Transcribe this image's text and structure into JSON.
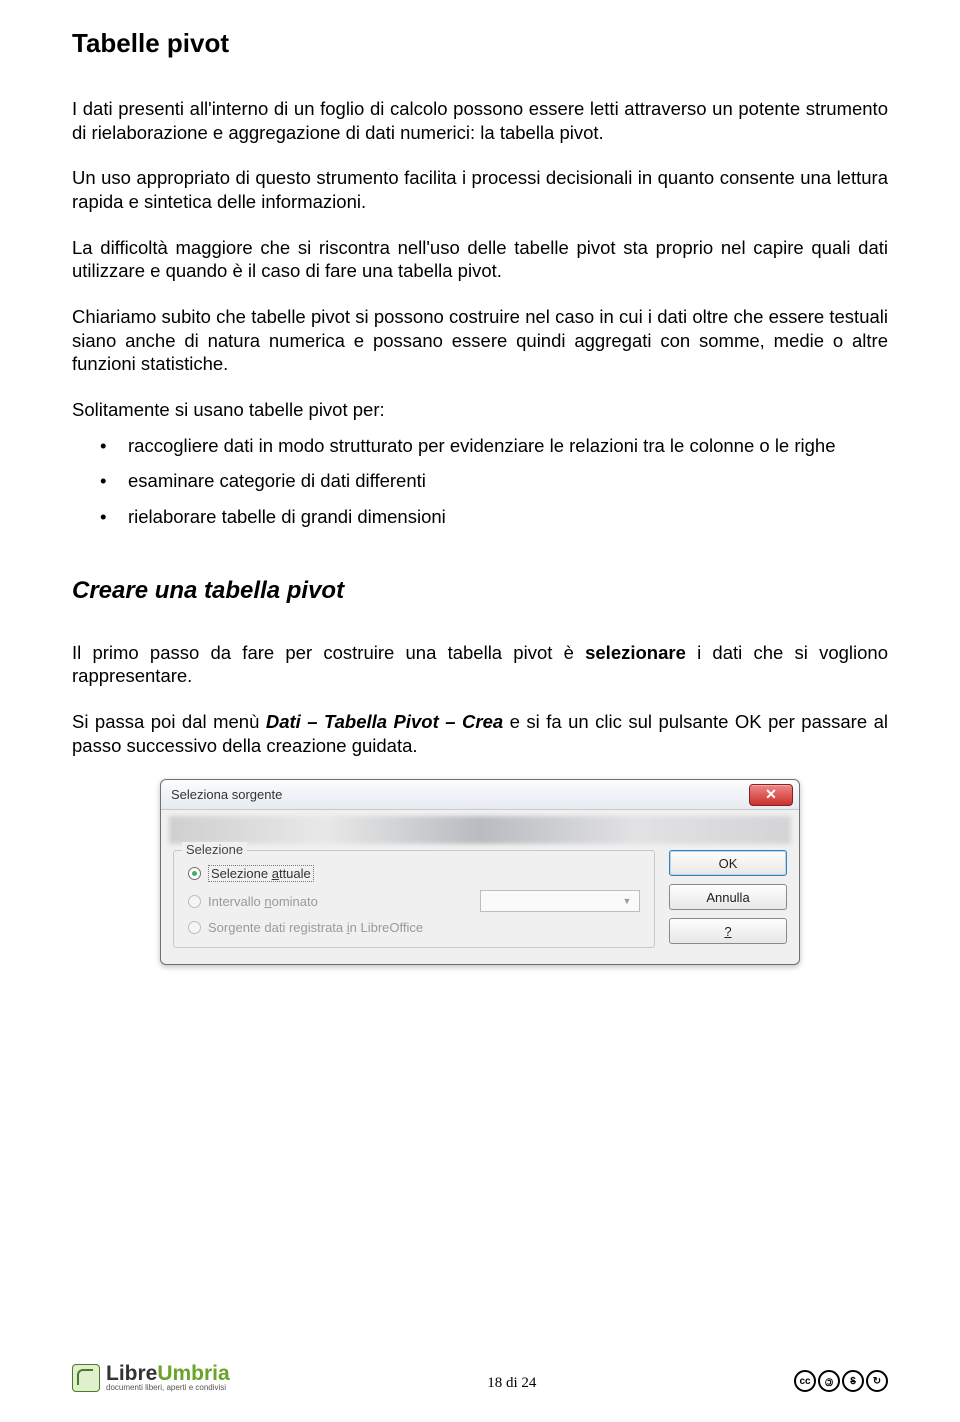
{
  "title": "Tabelle pivot",
  "p1": "I dati presenti all'interno di un foglio di calcolo possono essere letti attraverso un potente strumento di rielaborazione e aggregazione di dati numerici: la tabella pivot.",
  "p2": "Un uso appropriato di questo strumento facilita i processi decisionali in quanto consente una lettura rapida e sintetica delle informazioni.",
  "p3": "La difficoltà maggiore che si riscontra nell'uso delle tabelle pivot sta proprio nel capire quali dati utilizzare e quando è il caso di fare una tabella pivot.",
  "p4": "Chiariamo subito che tabelle pivot si possono costruire nel caso in cui i dati oltre che essere testuali siano anche di natura numerica e possano essere quindi aggregati con somme, medie o altre funzioni statistiche.",
  "list_intro": "Solitamente si usano tabelle pivot per:",
  "list": [
    "raccogliere dati in modo strutturato per evidenziare le relazioni tra le colonne o le righe",
    "esaminare categorie di dati differenti",
    "rielaborare tabelle di grandi dimensioni"
  ],
  "subtitle": "Creare una tabella pivot",
  "p5a": "Il primo passo da fare per costruire una tabella pivot è ",
  "p5b": "selezionare",
  "p5c": " i dati che si vogliono rappresentare.",
  "p6a": "Si passa poi dal menù ",
  "p6b": "Dati – Tabella Pivot – Crea",
  "p6c": " e si fa un clic sul pulsante OK per passare al passo successivo della creazione guidata.",
  "dialog": {
    "title": "Seleziona sorgente",
    "legend": "Selezione",
    "opt1_pre": "Selezione ",
    "opt1_u": "a",
    "opt1_post": "ttuale",
    "opt2_pre": "Intervallo ",
    "opt2_u": "n",
    "opt2_post": "ominato",
    "opt3_pre": "Sorgente dati registrata ",
    "opt3_u": "i",
    "opt3_post": "n LibreOffice",
    "ok": "OK",
    "cancel": "Annulla",
    "help": "?"
  },
  "footer": {
    "brand1": "Libre",
    "brand2": "Umbria",
    "tagline": "documenti liberi, aperti e condivisi",
    "page": "18 di 24",
    "cc": [
      "cc",
      "🄯",
      "$",
      "↻"
    ]
  }
}
